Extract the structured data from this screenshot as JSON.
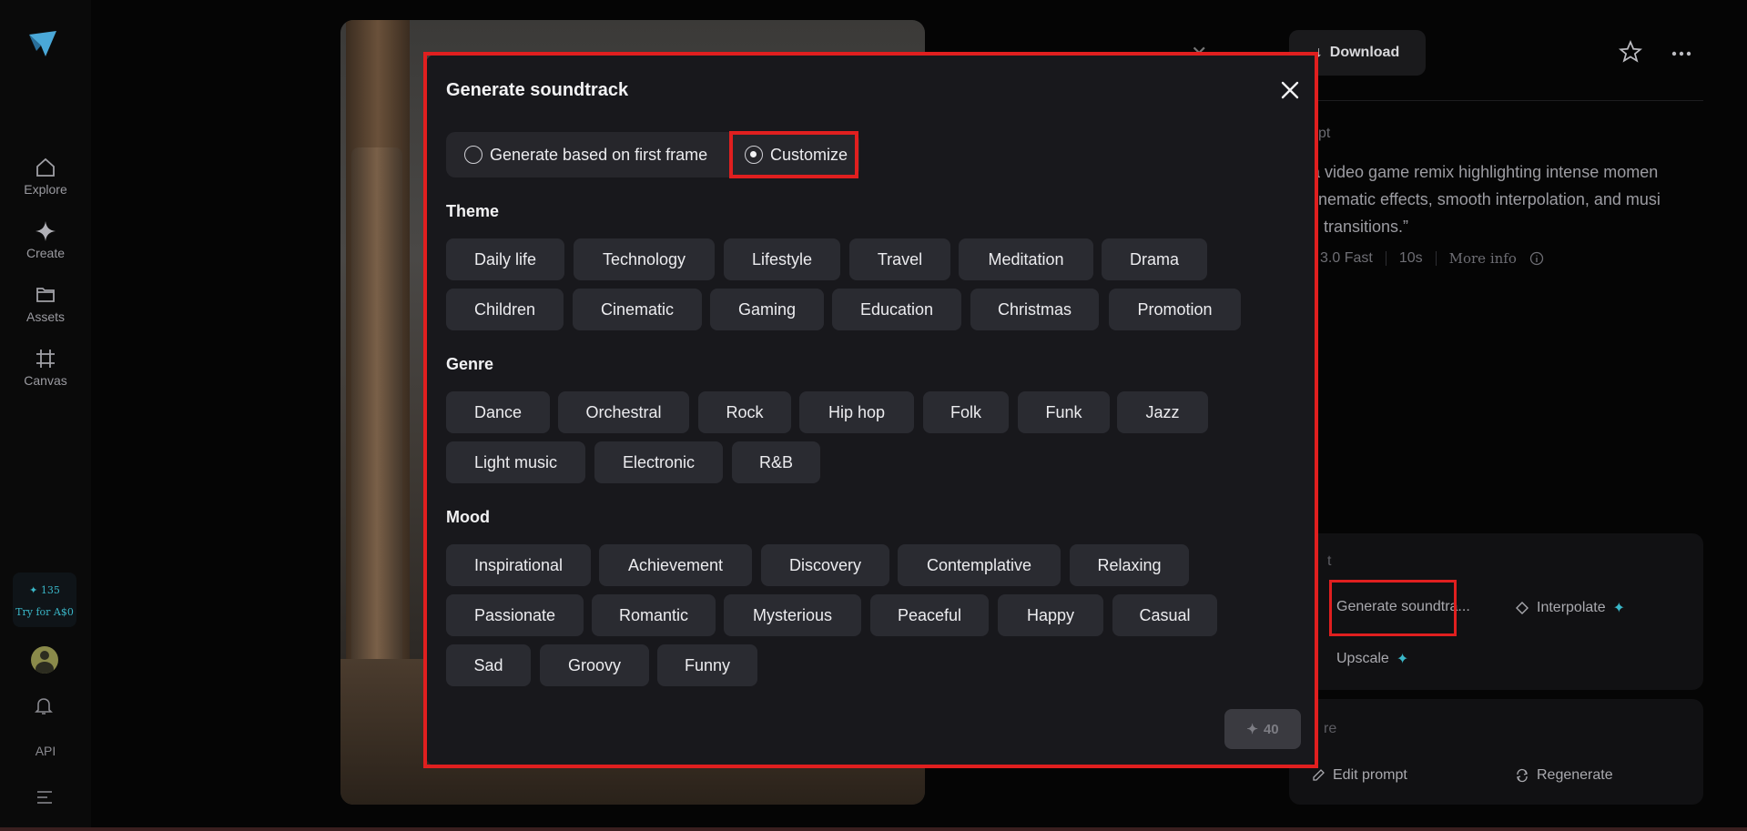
{
  "sidebar": {
    "items": [
      {
        "label": "Explore",
        "icon": "home-icon"
      },
      {
        "label": "Create",
        "icon": "sparkle-icon"
      },
      {
        "label": "Assets",
        "icon": "folder-icon"
      },
      {
        "label": "Canvas",
        "icon": "canvas-icon"
      }
    ],
    "credits_count": "135",
    "credits_offer": "Try for A$0",
    "api_label": "API"
  },
  "background": {
    "download_label": "Download",
    "prompt_title": "pt",
    "prompt_text": "te a video game remix highlighting intense momen\nh cinematic effects, smooth interpolation, and musi\nced transitions.”",
    "model": "3.0 Fast",
    "duration": "10s",
    "more_info": "More info",
    "edit_title": "t",
    "tools": {
      "generate_soundtrack": "Generate soundtra...",
      "interpolate": "Interpolate",
      "upscale": "Upscale",
      "edit_prompt": "Edit prompt",
      "regenerate": "Regenerate"
    },
    "more_title": "re"
  },
  "modal": {
    "title": "Generate soundtrack",
    "modes": {
      "first_frame": "Generate based on first frame",
      "customize": "Customize",
      "selected": "customize"
    },
    "theme_label": "Theme",
    "themes": [
      "Daily life",
      "Technology",
      "Lifestyle",
      "Travel",
      "Meditation",
      "Drama",
      "Children",
      "Cinematic",
      "Gaming",
      "Education",
      "Christmas",
      "Promotion"
    ],
    "genre_label": "Genre",
    "genres": [
      "Dance",
      "Orchestral",
      "Rock",
      "Hip hop",
      "Folk",
      "Funk",
      "Jazz",
      "Light music",
      "Electronic",
      "R&B"
    ],
    "mood_label": "Mood",
    "moods": [
      "Inspirational",
      "Achievement",
      "Discovery",
      "Contemplative",
      "Relaxing",
      "Passionate",
      "Romantic",
      "Mysterious",
      "Peaceful",
      "Happy",
      "Casual",
      "Sad",
      "Groovy",
      "Funny"
    ],
    "generate_cost": "40"
  },
  "colors": {
    "highlight": "#e01f1f",
    "accent": "#3ab7c8",
    "chip": "#2a2b31",
    "modal": "#18181c"
  }
}
